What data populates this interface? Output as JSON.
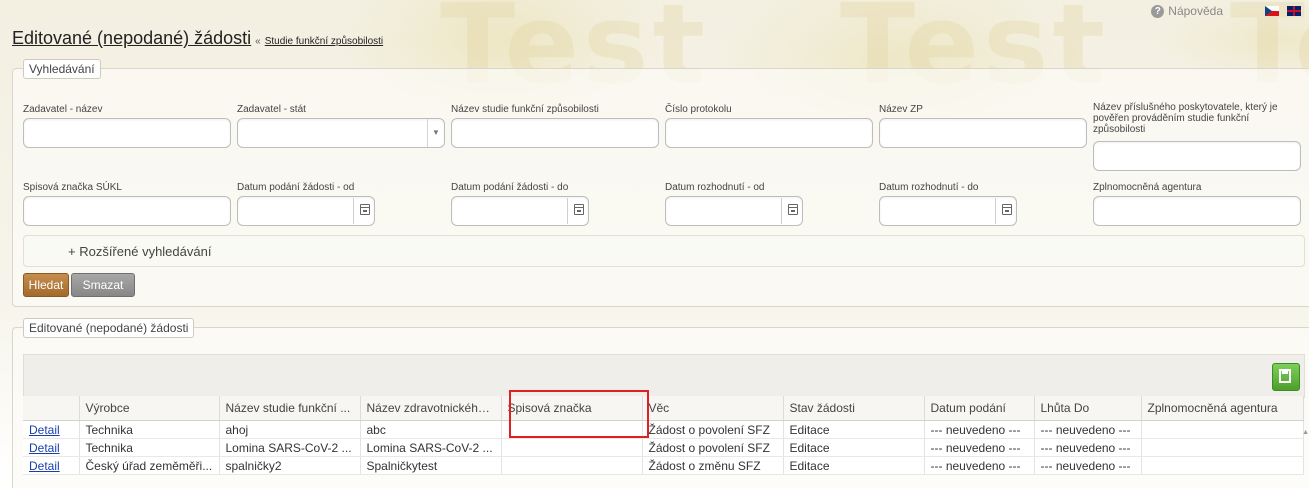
{
  "header": {
    "title": "Editované (nepodané) žádosti",
    "separator": "«",
    "breadcrumb": "Studie funkční způsobilosti",
    "help_label": "Nápověda",
    "watermark_text": "Test"
  },
  "search": {
    "legend": "Vyhledávání",
    "fields": {
      "zadavatel_nazev": {
        "label": "Zadavatel - název",
        "value": ""
      },
      "zadavatel_stat": {
        "label": "Zadavatel - stát",
        "value": ""
      },
      "nazev_studie": {
        "label": "Název studie funkční způsobilosti",
        "value": ""
      },
      "cislo_protokolu": {
        "label": "Číslo protokolu",
        "value": ""
      },
      "nazev_zp": {
        "label": "Název ZP",
        "value": ""
      },
      "poskytovatel": {
        "label": "Název příslušného poskytovatele, který je pověřen prováděním studie funkční způsobilosti",
        "value": ""
      },
      "spisova_znacka": {
        "label": "Spisová značka SÚKL",
        "value": ""
      },
      "datum_podani_od": {
        "label": "Datum podání žádosti - od",
        "value": ""
      },
      "datum_podani_do": {
        "label": "Datum podání žádosti - do",
        "value": ""
      },
      "datum_rozhodnuti_od": {
        "label": "Datum rozhodnutí - od",
        "value": ""
      },
      "datum_rozhodnuti_do": {
        "label": "Datum rozhodnutí - do",
        "value": ""
      },
      "agentura": {
        "label": "Zplnomocněná agentura",
        "value": ""
      }
    },
    "advanced_label": "+ Rozšířené vyhledávání",
    "search_button": "Hledat",
    "clear_button": "Smazat"
  },
  "results": {
    "legend": "Editované (nepodané) žádosti",
    "columns": [
      "",
      "Výrobce",
      "Název studie funkční ...",
      "Název zdravotnického...",
      "Spisová značka",
      "Věc",
      "Stav žádosti",
      "Datum podání",
      "Lhůta Do",
      "Zplnomocněná agentura"
    ],
    "rows": [
      [
        "Detail",
        "Technika",
        "ahoj",
        "abc",
        "",
        "Žádost o povolení SFZ",
        "Editace",
        "--- neuvedeno ---",
        "--- neuvedeno ---",
        ""
      ],
      [
        "Detail",
        "Technika",
        "Lomina SARS-CoV-2 ...",
        "Lomina SARS-CoV-2 ...",
        "",
        "Žádost o povolení SFZ",
        "Editace",
        "--- neuvedeno ---",
        "--- neuvedeno ---",
        ""
      ],
      [
        "Detail",
        "Český úřad zeměměři...",
        "spalničky2",
        "Spalničkytest",
        "",
        "Žádost o změnu SFZ",
        "Editace",
        "--- neuvedeno ---",
        "--- neuvedeno ---",
        ""
      ]
    ]
  },
  "colors": {
    "search_button": "#b27a3a",
    "clear_button": "#999999",
    "save_button": "#5cb83a",
    "highlight": "#e02020",
    "link": "#1a3fa8"
  }
}
